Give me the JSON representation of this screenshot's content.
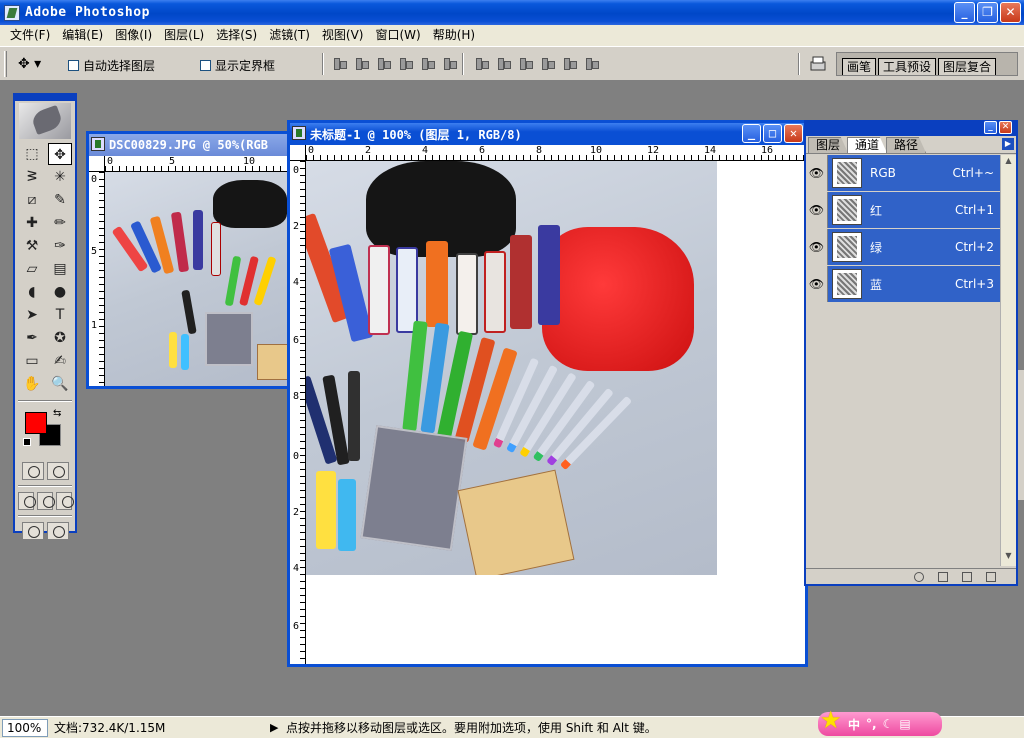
{
  "app": {
    "title": "Adobe Photoshop",
    "window_buttons": [
      "_",
      "❐",
      "✕"
    ]
  },
  "menu": [
    "文件(F)",
    "编辑(E)",
    "图像(I)",
    "图层(L)",
    "选择(S)",
    "滤镜(T)",
    "视图(V)",
    "窗口(W)",
    "帮助(H)"
  ],
  "options": {
    "auto_select_layer": "自动选择图层",
    "show_bounding_box": "显示定界框",
    "palette_well_tabs": [
      "画笔",
      "工具预设",
      "图层复合"
    ]
  },
  "toolbox": {
    "foreground_color": "#ff0000",
    "background_color": "#000000",
    "tools": [
      "marquee-icon",
      "move-icon",
      "lasso-icon",
      "magic-wand-icon",
      "crop-icon",
      "slice-icon",
      "healing-brush-icon",
      "brush-icon",
      "clone-stamp-icon",
      "history-brush-icon",
      "eraser-icon",
      "gradient-icon",
      "blur-icon",
      "dodge-icon",
      "path-selection-icon",
      "type-icon",
      "pen-icon",
      "custom-shape-icon",
      "notes-icon",
      "eyedropper-icon",
      "hand-icon",
      "zoom-icon"
    ],
    "tool_glyphs": [
      "⬚",
      "✥",
      "ᕒ",
      "✳",
      "⧄",
      "✎",
      "✚",
      "✏",
      "⚒",
      "✑",
      "▱",
      "▤",
      "◖",
      "●",
      "➤",
      "T",
      "✒",
      "✪",
      "▭",
      "✍",
      "✋",
      "🔍"
    ]
  },
  "docs": {
    "back": {
      "title": "DSC00829.JPG @ 50%(RGB",
      "ruler_top": [
        "0",
        "5",
        "10"
      ],
      "ruler_left": [
        "0",
        "5",
        "1"
      ]
    },
    "front": {
      "title": "未标题-1 @ 100% (图层 1, RGB/8)",
      "ruler_top": [
        "0",
        "2",
        "4",
        "6",
        "8",
        "10",
        "12",
        "14",
        "16"
      ],
      "ruler_left": [
        "0",
        "2",
        "4",
        "6",
        "8",
        "0",
        "2",
        "4",
        "6"
      ],
      "window_buttons": [
        "_",
        "□",
        "✕"
      ]
    }
  },
  "channels": {
    "tabs": [
      "图层",
      "通道",
      "路径"
    ],
    "active_tab": "通道",
    "rows": [
      {
        "name": "RGB",
        "shortcut": "Ctrl+~"
      },
      {
        "name": "红",
        "shortcut": "Ctrl+1"
      },
      {
        "name": "绿",
        "shortcut": "Ctrl+2"
      },
      {
        "name": "蓝",
        "shortcut": "Ctrl+3"
      }
    ]
  },
  "status": {
    "zoom": "100%",
    "doc_size": "文档:732.4K/1.15M",
    "message": "点按并拖移以移动图层或选区。要用附加选项，使用 Shift 和 Alt 键。"
  },
  "ime": {
    "label": "中"
  }
}
